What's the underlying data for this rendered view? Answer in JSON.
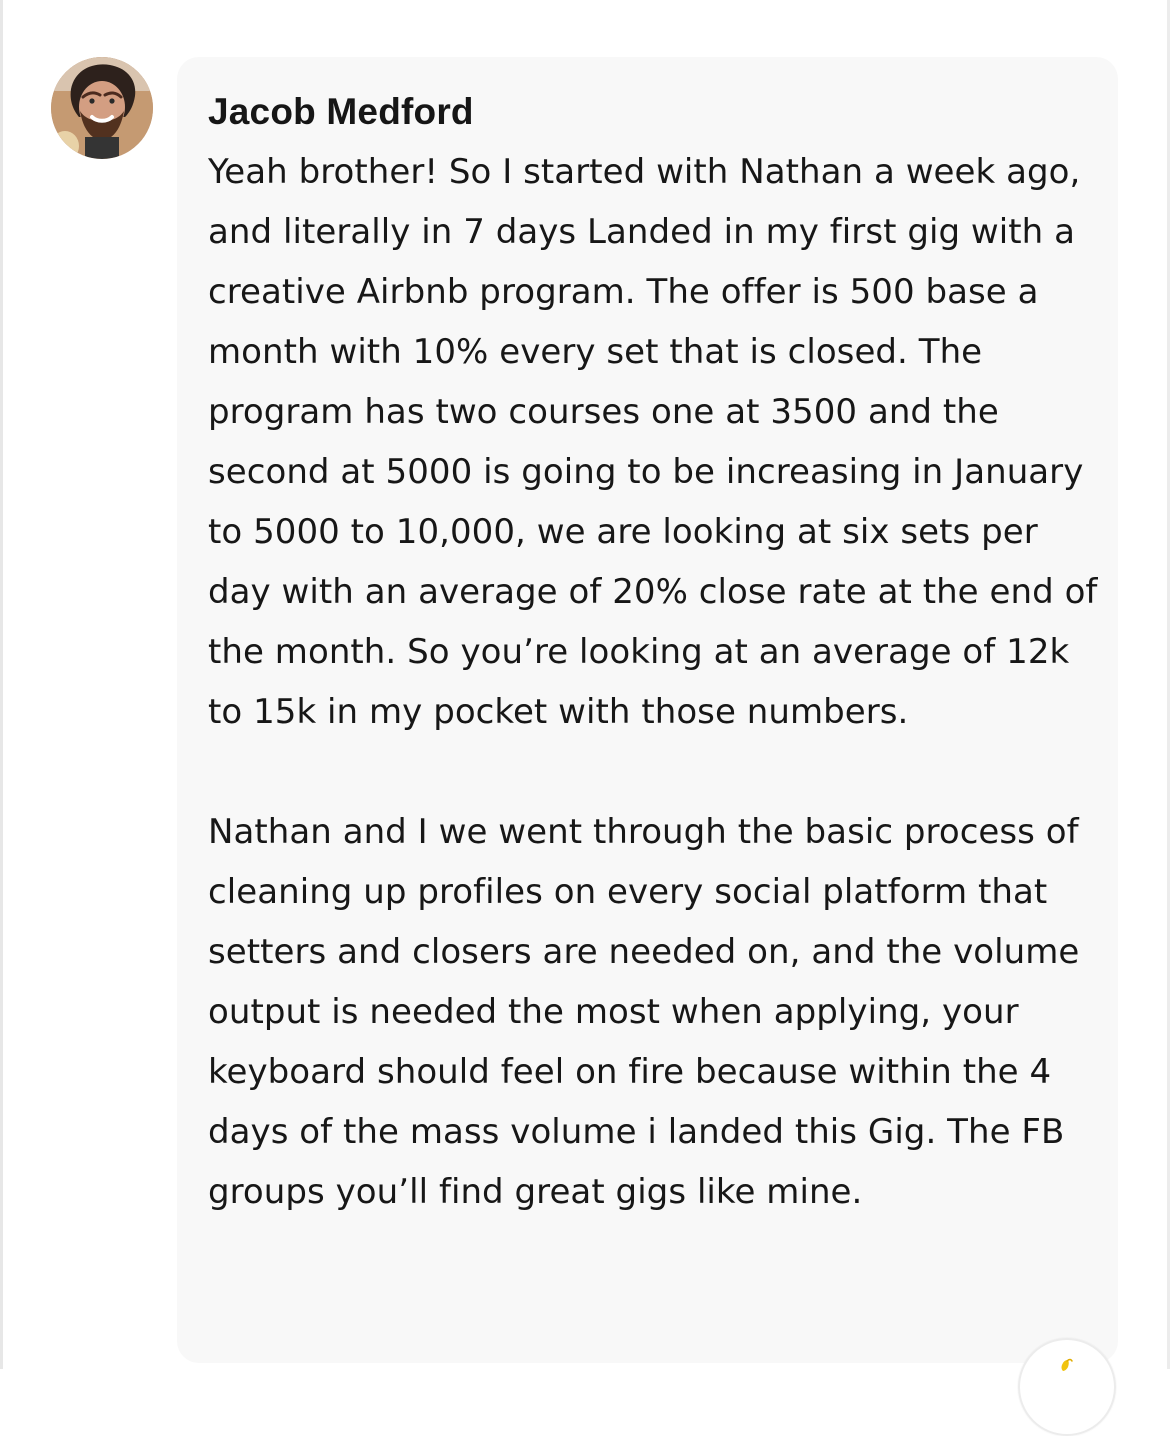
{
  "comment": {
    "author": "Jacob Medford",
    "paragraphs": [
      "Yeah brother! So I started with Nathan a week ago, and literally in 7 days Landed in my first gig with a creative Airbnb program. The offer is 500 base a month with 10% every set that is closed. The program has two courses one at 3500 and the second at 5000 is going to be increasing in January to 5000 to 10,000,  we are looking at six sets per day with an average of 20% close rate at the end of the month. So you’re looking at an average of 12k to 15k in my pocket with those numbers.",
      "Nathan and I we went through the basic process of cleaning up profiles on every social platform that setters and closers are needed on, and the volume output is needed the most when applying, your keyboard should feel on fire because within the 4 days of the mass volume i landed this Gig. The FB groups you’ll find great gigs like mine."
    ]
  },
  "icons": {
    "avatar": "profile-avatar",
    "reaction": "reaction-emoji-icon"
  },
  "colors": {
    "bubble": "#f8f8f8",
    "text": "#171717",
    "accent": "#f1c40f"
  }
}
